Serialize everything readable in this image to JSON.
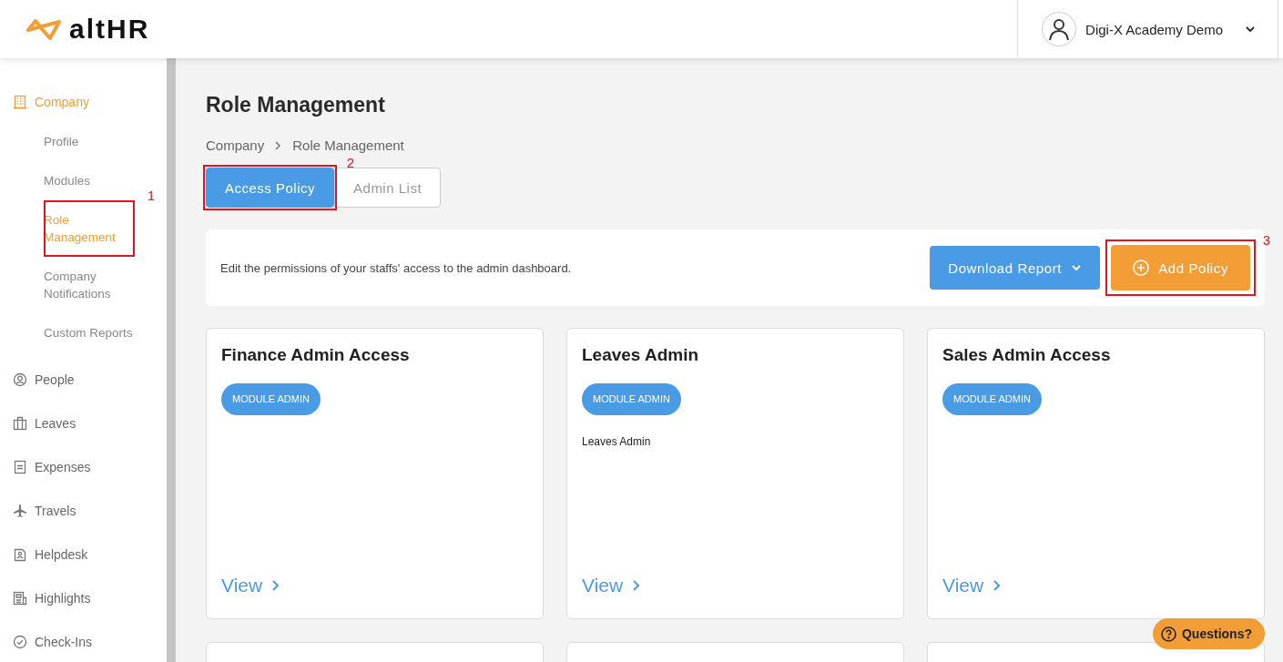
{
  "header": {
    "logo": "altHR",
    "account": {
      "name": "Digi-X Academy Demo"
    }
  },
  "sidebar": {
    "items": [
      {
        "label": "Company",
        "selected": true,
        "children": [
          {
            "label": "Profile",
            "selected": false
          },
          {
            "label": "Modules",
            "selected": false
          },
          {
            "label": "Role Management",
            "selected": true,
            "callout": "1"
          },
          {
            "label": "Company Notifications",
            "selected": false
          },
          {
            "label": "Custom Reports",
            "selected": false
          }
        ]
      },
      {
        "label": "People",
        "selected": false
      },
      {
        "label": "Leaves",
        "selected": false
      },
      {
        "label": "Expenses",
        "selected": false
      },
      {
        "label": "Travels",
        "selected": false
      },
      {
        "label": "Helpdesk",
        "selected": false
      },
      {
        "label": "Highlights",
        "selected": false
      },
      {
        "label": "Check-Ins",
        "selected": false
      }
    ]
  },
  "page": {
    "title": "Role Management",
    "breadcrumb": [
      "Company",
      "Role Management"
    ],
    "tabs": [
      {
        "label": "Access Policy",
        "selected": true,
        "callout": "2"
      },
      {
        "label": "Admin List",
        "selected": false
      }
    ],
    "toolbar": {
      "description": "Edit the permissions of your staffs' access to the admin dashboard.",
      "buttons": [
        {
          "label": "Download Report",
          "kind": "dropdown"
        },
        {
          "label": "Add Policy",
          "kind": "add",
          "callout": "3"
        }
      ]
    },
    "cards": [
      {
        "kind": "policy",
        "title": "Finance Admin Access",
        "badge": "MODULE ADMIN",
        "link": "View"
      },
      {
        "kind": "policy",
        "title": "Leaves Admin",
        "badge": "MODULE ADMIN",
        "description": "Leaves Admin",
        "link": "View"
      },
      {
        "kind": "policy",
        "title": "Sales Admin Access",
        "badge": "MODULE ADMIN",
        "link": "View"
      },
      {
        "kind": "cut"
      },
      {
        "kind": "cut"
      },
      {
        "kind": "cut"
      }
    ]
  },
  "help_button": {
    "label": "Questions?"
  }
}
